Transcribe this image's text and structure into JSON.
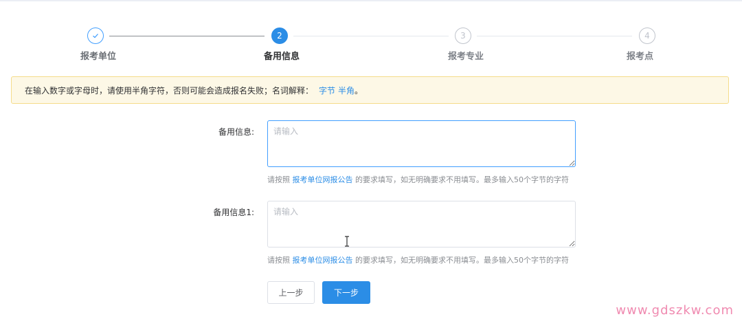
{
  "steps": [
    {
      "title": "报考单位",
      "status": "finished",
      "icon": "check-icon"
    },
    {
      "title": "备用信息",
      "status": "active",
      "number": "2"
    },
    {
      "title": "报考专业",
      "status": "wait",
      "number": "3"
    },
    {
      "title": "报考点",
      "status": "wait",
      "number": "4"
    }
  ],
  "alert": {
    "text": "在输入数字或字母时，请使用半角字符，否则可能会造成报名失败；名词解释：",
    "link_byte": "字节",
    "link_halfwidth": "半角",
    "suffix": "。"
  },
  "form": {
    "fields": [
      {
        "label": "备用信息:",
        "placeholder": "请输入",
        "hint_prefix": "请按照 ",
        "hint_link": "报考单位网报公告",
        "hint_suffix": " 的要求填写，如无明确要求不用填写。最多输入50个字节的字符"
      },
      {
        "label": "备用信息1:",
        "placeholder": "请输入",
        "hint_prefix": "请按照 ",
        "hint_link": "报考单位网报公告",
        "hint_suffix": " 的要求填写，如无明确要求不用填写。最多输入50个字节的字符"
      }
    ]
  },
  "buttons": {
    "prev": "上一步",
    "next": "下一步"
  },
  "watermark": "www.gdszkw.com",
  "colors": {
    "primary": "#2b8de6",
    "alert_bg": "#fdf8e6",
    "alert_border": "#f5dc8a"
  }
}
